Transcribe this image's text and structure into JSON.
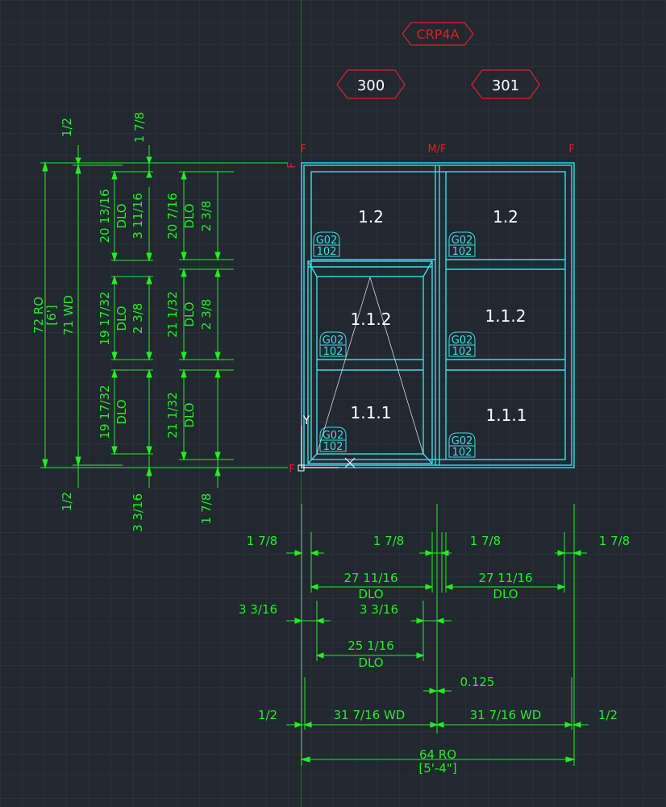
{
  "colors": {
    "background": "#212830",
    "grid": "#2e3744",
    "dim": "#22ee22",
    "frame": "#33e0e8",
    "red": "#e02020",
    "label": "#ffffff"
  },
  "tags": {
    "top": "CRP4A",
    "left": "300",
    "right": "301"
  },
  "frame_marks": {
    "left": "F",
    "center": "M/F",
    "right": "F",
    "side_top": "F",
    "side_bottom": "F"
  },
  "panels": {
    "upper": "1.2",
    "middle": "1.1.2",
    "lower": "1.1.1"
  },
  "glass_badge": {
    "top": "G02",
    "bottom": "102"
  },
  "ucs": {
    "y": "Y"
  },
  "vertical_dims": {
    "top_edge": "1/2",
    "top_bar": "1 7/8",
    "bottom_edge": "1/2",
    "bottom_mid": "3 3/16",
    "bottom_right": "1 7/8",
    "overall_ro": "72 RO",
    "overall_ft": "[6']",
    "overall_wd": "71 WD",
    "c1r1": "20 13/16",
    "c1r1_dlo": "DLO",
    "c1r1_sub": "3 11/16",
    "c1r2": "19 17/32",
    "c1r2_dlo": "DLO",
    "c1r2_sub": "2 3/8",
    "c1r3": "19 17/32",
    "c1r3_dlo": "DLO",
    "c2r1": "20 7/16",
    "c2r1_dlo": "DLO",
    "c2r1_sub": "2 3/8",
    "c2r2": "21 1/32",
    "c2r2_dlo": "DLO",
    "c2r2_sub": "2 3/8",
    "c2r3": "21 1/32",
    "c2r3_dlo": "DLO"
  },
  "horizontal_dims": {
    "left_jamb": "1 7/8",
    "mullion_left": "1 7/8",
    "mullion_right": "1 7/8",
    "right_jamb": "1 7/8",
    "dlo_left": "27 11/16",
    "dlo_left_label": "DLO",
    "dlo_right": "27 11/16",
    "dlo_right_label": "DLO",
    "sash_left": "3 3/16",
    "sash_mid": "3 3/16",
    "sash_dlo": "25 1/16",
    "sash_dlo_label": "DLO",
    "gap": "0.125",
    "edge_left": "1/2",
    "unit_left": "31 7/16 WD",
    "unit_right": "31 7/16 WD",
    "edge_right": "1/2",
    "overall_ro": "64 RO",
    "overall_ft": "[5'-4\"]"
  }
}
